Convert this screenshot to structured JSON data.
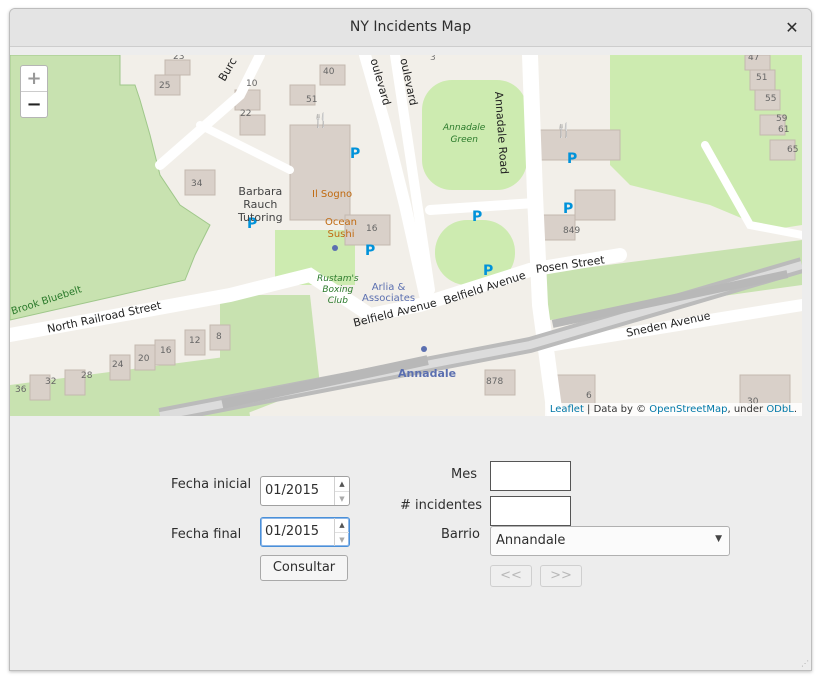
{
  "window": {
    "title": "NY Incidents Map",
    "close_icon": "close-icon"
  },
  "map": {
    "zoom_in": "+",
    "zoom_out": "−",
    "attribution": {
      "leaflet": "Leaflet",
      "data_by": " | Data by © ",
      "osm": "OpenStreetMap",
      "under": ", under ",
      "license": "ODbL",
      "end": "."
    },
    "labels": {
      "north_railroad": "North Railroad Street",
      "belfield1": "Belfield Avenue",
      "belfield2": "Belfield Avenue",
      "posen": "Posen Street",
      "sneden": "Sneden Avenue",
      "annadale_road": "Annadale Road",
      "boulevard1": "oulevard",
      "boulevard2": "oulevard",
      "burch": "Burc",
      "brook": "Brook Bluebelt",
      "barbara1": "Barbara",
      "barbara2": "Rauch",
      "barbara3": "Tutoring",
      "sogno": "Il Sogno",
      "ocean1": "Ocean",
      "ocean2": "Sushi",
      "rustam1": "Rustam's",
      "rustam2": "Boxing",
      "rustam3": "Club",
      "arlia1": "Arlia &",
      "arlia2": "Associates",
      "green1": "Annadale",
      "green2": "Green",
      "station": "Annadale",
      "n3": "3",
      "n23": "23",
      "n25": "25",
      "n10": "10",
      "n22": "22",
      "n40": "40",
      "n51": "51",
      "n34": "34",
      "n16a": "16",
      "n16b": "16",
      "n47": "47",
      "n51b": "51",
      "n55": "55",
      "n59": "59",
      "n61": "61",
      "n65": "65",
      "n849": "849",
      "n878": "878",
      "n36": "36",
      "n32": "32",
      "n28": "28",
      "n24": "24",
      "n20": "20",
      "n12": "12",
      "n8": "8",
      "n6": "6",
      "n30": "30"
    }
  },
  "form": {
    "fecha_inicial_label": "Fecha inicial",
    "fecha_inicial_value": "01/2015",
    "fecha_final_label": "Fecha final",
    "fecha_final_value": "01/2015",
    "consultar": "Consultar",
    "mes_label": "Mes",
    "incidentes_label": "# incidentes",
    "barrio_label": "Barrio",
    "barrio_value": "Annandale",
    "prev": "<<",
    "next": ">>"
  }
}
